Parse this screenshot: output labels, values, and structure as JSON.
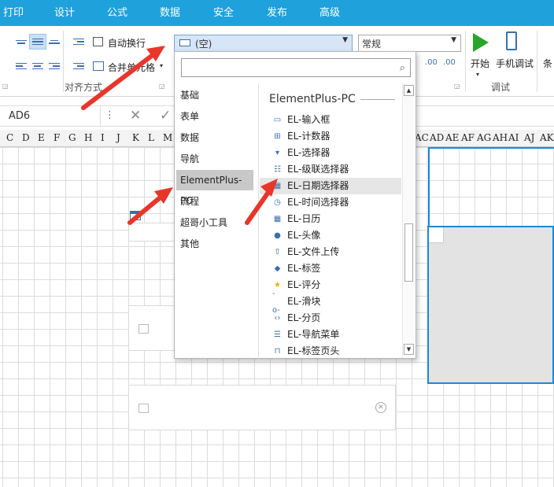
{
  "menu": [
    "打印",
    "设计",
    "公式",
    "数据",
    "安全",
    "发布",
    "高级"
  ],
  "ribbon": {
    "wrap_text": "自动换行",
    "merge_center": "合并单元格",
    "align_group": "对齐方式",
    "control_combo": "(空)",
    "format_combo": "常规",
    "start_button": "开始",
    "mobile_debug_button": "手机调试",
    "debug_group": "调试",
    "cut_text": "条"
  },
  "formula_bar": {
    "name_box": "AD6"
  },
  "columns_left": [
    "C",
    "D",
    "E",
    "F",
    "G",
    "H",
    "I",
    "J",
    "K",
    "L",
    "M"
  ],
  "columns_right": [
    "AC",
    "AD",
    "AE",
    "AF",
    "AG",
    "AH",
    "AI",
    "AJ",
    "AK"
  ],
  "dropdown": {
    "search_placeholder": "",
    "categories": [
      "基础",
      "表单",
      "数据",
      "导航",
      "ElementPlus-PC",
      "流程",
      "超哥小工具",
      "其他"
    ],
    "active_category": "ElementPlus-PC",
    "section_title": "ElementPlus-PC",
    "items": [
      {
        "label": "EL-输入框",
        "icon": "input-icon"
      },
      {
        "label": "EL-计数器",
        "icon": "counter-icon"
      },
      {
        "label": "EL-选择器",
        "icon": "select-icon"
      },
      {
        "label": "EL-级联选择器",
        "icon": "cascader-icon"
      },
      {
        "label": "EL-日期选择器",
        "icon": "date-picker-icon"
      },
      {
        "label": "EL-时间选择器",
        "icon": "clock-icon"
      },
      {
        "label": "EL-日历",
        "icon": "calendar-icon"
      },
      {
        "label": "EL-头像",
        "icon": "avatar-icon"
      },
      {
        "label": "EL-文件上传",
        "icon": "upload-icon"
      },
      {
        "label": "EL-标签",
        "icon": "tag-icon"
      },
      {
        "label": "EL-评分",
        "icon": "star-icon"
      },
      {
        "label": "EL-滑块",
        "icon": "slider-icon"
      },
      {
        "label": "EL-分页",
        "icon": "pagination-icon"
      },
      {
        "label": "EL-导航菜单",
        "icon": "menu-icon"
      },
      {
        "label": "EL-标签页头",
        "icon": "tabs-icon"
      }
    ],
    "highlighted_item": "EL-日期选择器"
  },
  "colors": {
    "menubar": "#1fa1dc",
    "arrow": "#e8362b",
    "selection": "#1a8ad4"
  }
}
